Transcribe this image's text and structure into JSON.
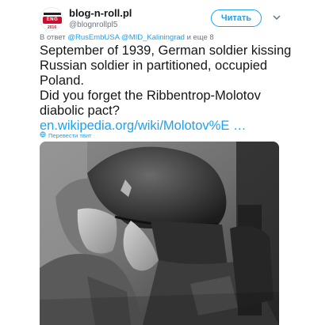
{
  "user": {
    "display_name": "blog-n-roll.pl",
    "handle": "@blognrollpl5",
    "avatar_text": "ENG",
    "avatar_sub": "2016"
  },
  "follow_label": "Читать",
  "reply": {
    "prefix": "В ответ",
    "mention1": "@RusEmbUSA",
    "mention2": "@MID_Kaliningrad",
    "suffix": "и еще 8"
  },
  "tweet": {
    "line1": "September of 1939, German soldier kissing",
    "line2": "Russian soldier in partitioned, occupied",
    "line3": "Poland.",
    "line4": "Did you forget the Ribbentrop-Molotov",
    "line5": "diabolic pact?",
    "link": "en.wikipedia.org/wiki/Molotov%E …"
  },
  "translate_label": "Перевести твит",
  "icons": {
    "chevron": "chevron-down-icon",
    "globe": "globe-icon"
  },
  "colors": {
    "accent": "#1da1f2",
    "text": "#14171a",
    "muted": "#657786"
  }
}
